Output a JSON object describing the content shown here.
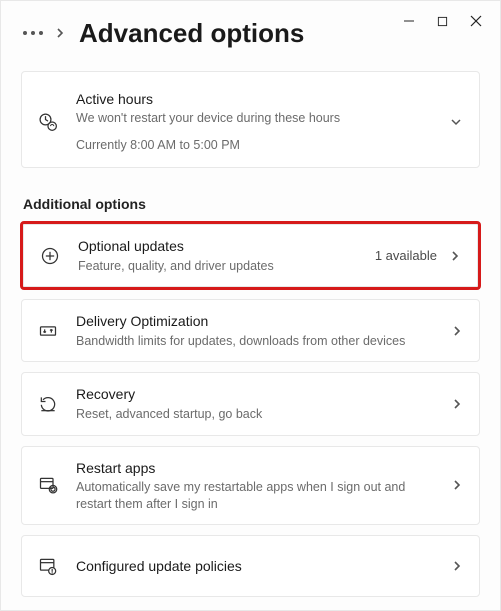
{
  "header": {
    "title": "Advanced options"
  },
  "activeHours": {
    "title": "Active hours",
    "sub": "We won't restart your device during these hours",
    "extra": "Currently 8:00 AM to 5:00 PM"
  },
  "sectionTitle": "Additional options",
  "items": {
    "optional": {
      "title": "Optional updates",
      "sub": "Feature, quality, and driver updates",
      "trailing": "1 available"
    },
    "delivery": {
      "title": "Delivery Optimization",
      "sub": "Bandwidth limits for updates, downloads from other devices"
    },
    "recovery": {
      "title": "Recovery",
      "sub": "Reset, advanced startup, go back"
    },
    "restart": {
      "title": "Restart apps",
      "sub": "Automatically save my restartable apps when I sign out and restart them after I sign in"
    },
    "policies": {
      "title": "Configured update policies"
    }
  }
}
